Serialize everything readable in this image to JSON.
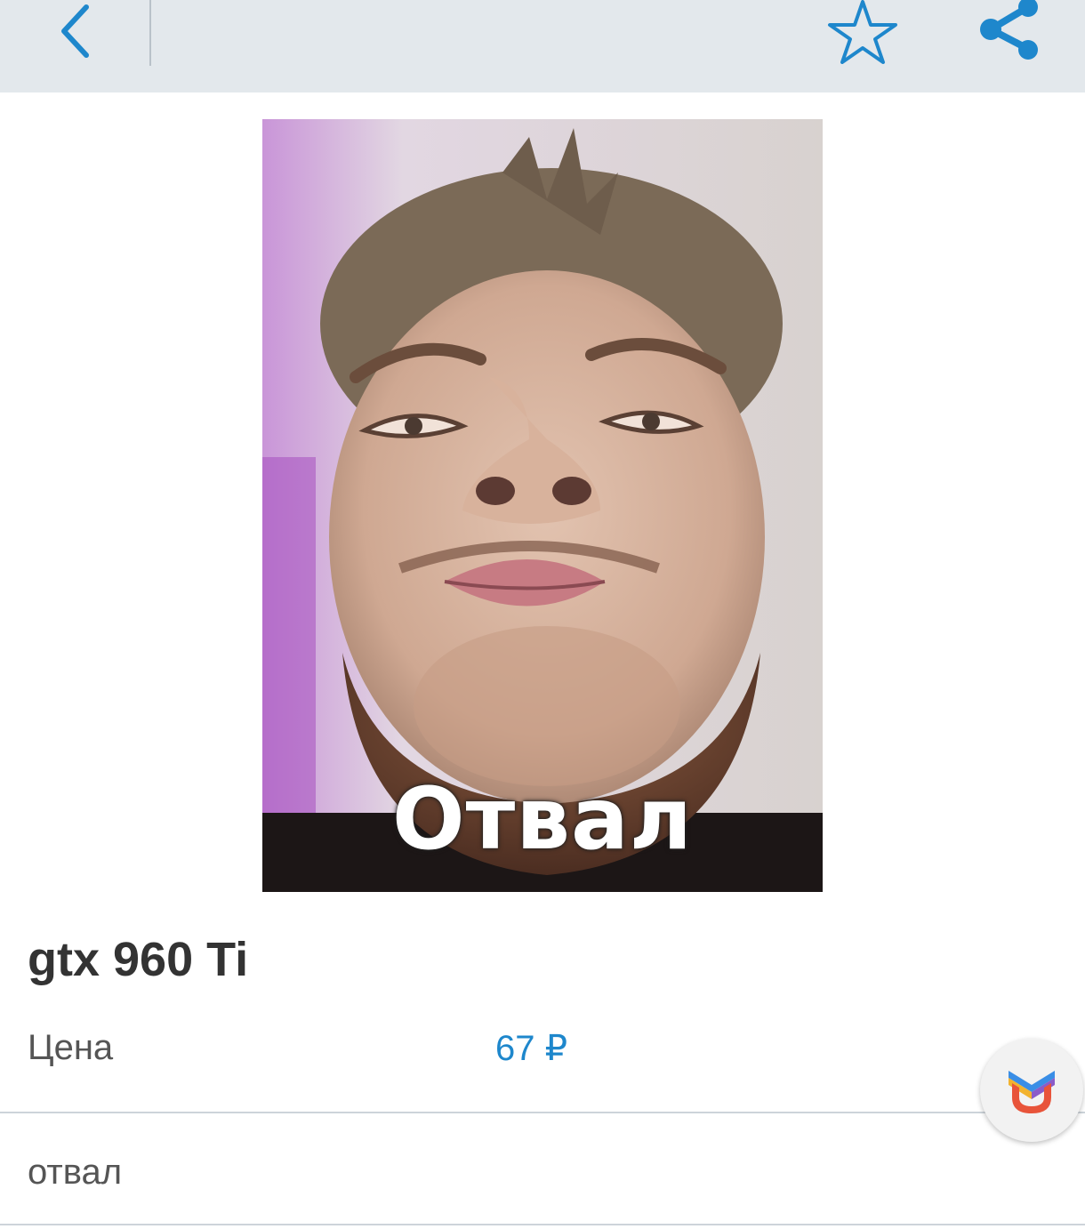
{
  "header": {
    "back_icon": "chevron-left-icon",
    "favorite_icon": "star-outline-icon",
    "share_icon": "share-icon",
    "accent_color": "#1e87cc"
  },
  "listing": {
    "photo_caption": "Отвал",
    "title": "gtx 960 Ti",
    "price_label": "Цена",
    "price_value": "67 ₽",
    "description": "отвал"
  },
  "fab": {
    "icon": "app-logo-icon"
  }
}
